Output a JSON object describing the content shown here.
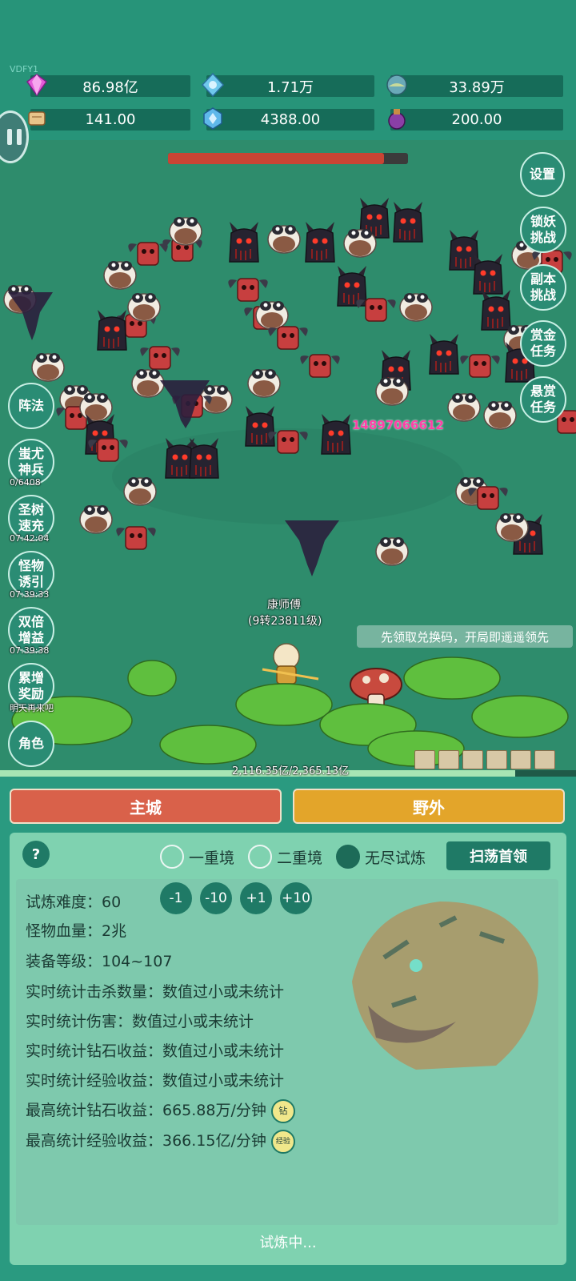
{
  "version": "VDFY1",
  "resources": [
    {
      "icon": "gem-icon",
      "value": "86.98亿"
    },
    {
      "icon": "crystal-icon",
      "value": "1.71万"
    },
    {
      "icon": "orb-icon",
      "value": "33.89万"
    },
    {
      "icon": "scroll-icon",
      "value": "141.00"
    },
    {
      "icon": "shard-icon",
      "value": "4388.00"
    },
    {
      "icon": "potion-icon",
      "value": "200.00"
    }
  ],
  "boss_hp_fraction": 0.9,
  "right_buttons": [
    "设置",
    "锁妖\n挑战",
    "副本\n挑战",
    "赏金\n任务",
    "悬赏\n任务"
  ],
  "left_buttons": [
    {
      "label": "阵法",
      "timer": ""
    },
    {
      "label": "蚩尤\n神兵",
      "timer": "0/6408"
    },
    {
      "label": "圣树\n速充",
      "timer": "07:42:04"
    },
    {
      "label": "怪物\n诱引",
      "timer": "07:39:33"
    },
    {
      "label": "双倍\n增益",
      "timer": "07:39:38"
    },
    {
      "label": "累增\n奖励",
      "timer": "明天再来吧"
    },
    {
      "label": "角色",
      "timer": ""
    }
  ],
  "damage_number": "14897066612",
  "player": {
    "name": "康师傅",
    "level": "(9转23811级)"
  },
  "tip": "先领取兑换码，开局即遥遥领先",
  "exp": {
    "text": "2,116.35亿/2,365.13亿",
    "fraction": 0.895
  },
  "tabs": {
    "city": "主城",
    "wild": "野外"
  },
  "help": "?",
  "modes": [
    "一重境",
    "二重境",
    "无尽试炼"
  ],
  "selected_mode": 2,
  "sweep": "扫荡首领",
  "difficulty": {
    "label": "试炼难度：",
    "value": "60",
    "buttons": [
      "-1",
      "-10",
      "+1",
      "+10"
    ]
  },
  "stats": [
    "怪物血量：2兆",
    "装备等级：104~107",
    "实时统计击杀数量：数值过小或未统计",
    "实时统计伤害：数值过小或未统计",
    "实时统计钻石收益：数值过小或未统计",
    "实时统计经验收益：数值过小或未统计"
  ],
  "best_diamond": {
    "text": "最高统计钻石收益：665.88万/分钟",
    "badge": "钻"
  },
  "best_exp": {
    "text": "最高统计经验收益：366.15亿/分钟",
    "badge": "经验"
  },
  "status": "试炼中...",
  "colors": {
    "city": "#d9614a",
    "wild": "#e3a52a",
    "panel": "#7fd2b0",
    "accent": "#1f7a66"
  }
}
